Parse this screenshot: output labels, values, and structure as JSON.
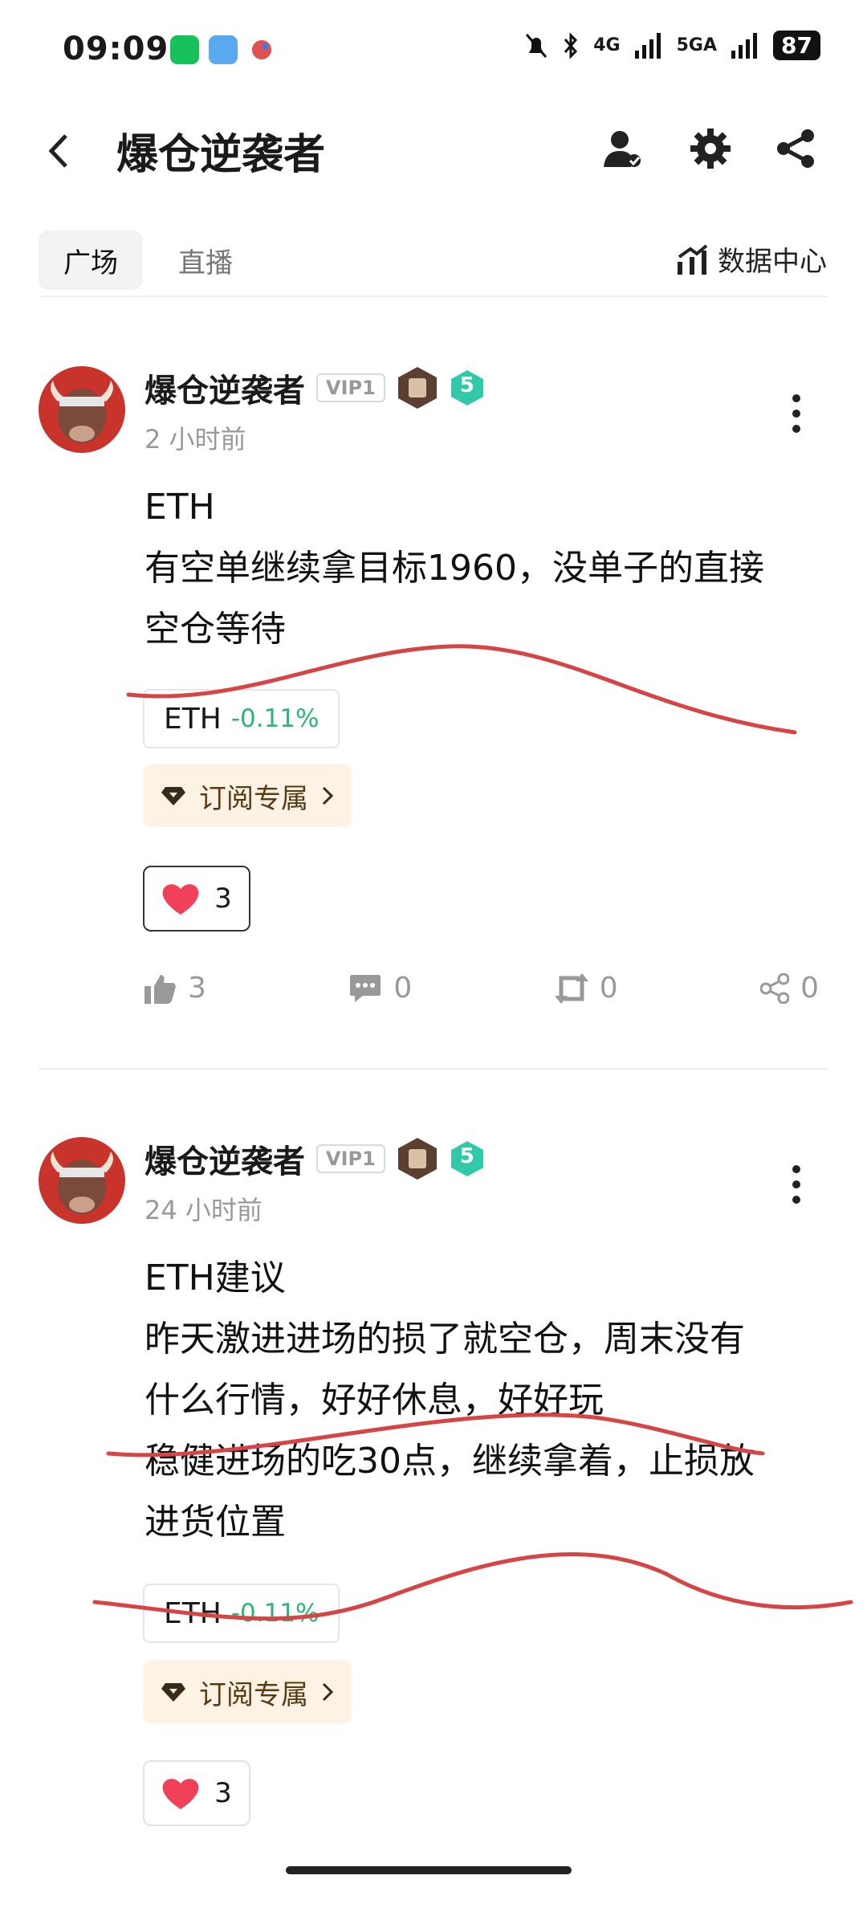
{
  "status_bar": {
    "time": "09:09",
    "network_1": "4G",
    "network_2": "5GA",
    "battery": "87"
  },
  "header": {
    "title": "爆仓逆袭者"
  },
  "tabs": {
    "active": "广场",
    "other": "直播",
    "data_center": "数据中心"
  },
  "posts": [
    {
      "author": "爆仓逆袭者",
      "vip": "VIP1",
      "level": "5",
      "time": "2 小时前",
      "lines": [
        "ETH",
        "有空单继续拿目标1960，没单子的直接",
        "空仓等待"
      ],
      "tag_symbol": "ETH",
      "tag_change": "-0.11%",
      "subscribe_label": "订阅专属",
      "reaction_count": "3",
      "likes": "3",
      "comments": "0",
      "reposts": "0",
      "shares": "0"
    },
    {
      "author": "爆仓逆袭者",
      "vip": "VIP1",
      "level": "5",
      "time": "24 小时前",
      "lines": [
        "ETH建议",
        "昨天激进进场的损了就空仓，周末没有",
        "什么行情，好好休息，好好玩",
        "稳健进场的吃30点，继续拿着，止损放",
        "进货位置"
      ],
      "tag_symbol": "ETH",
      "tag_change": "-0.11%",
      "subscribe_label": "订阅专属",
      "reaction_count": "3"
    }
  ],
  "colors": {
    "positive": "#2bb673",
    "annotation": "#d64545",
    "heart": "#f0405a",
    "level_badge": "#31c9a8"
  }
}
